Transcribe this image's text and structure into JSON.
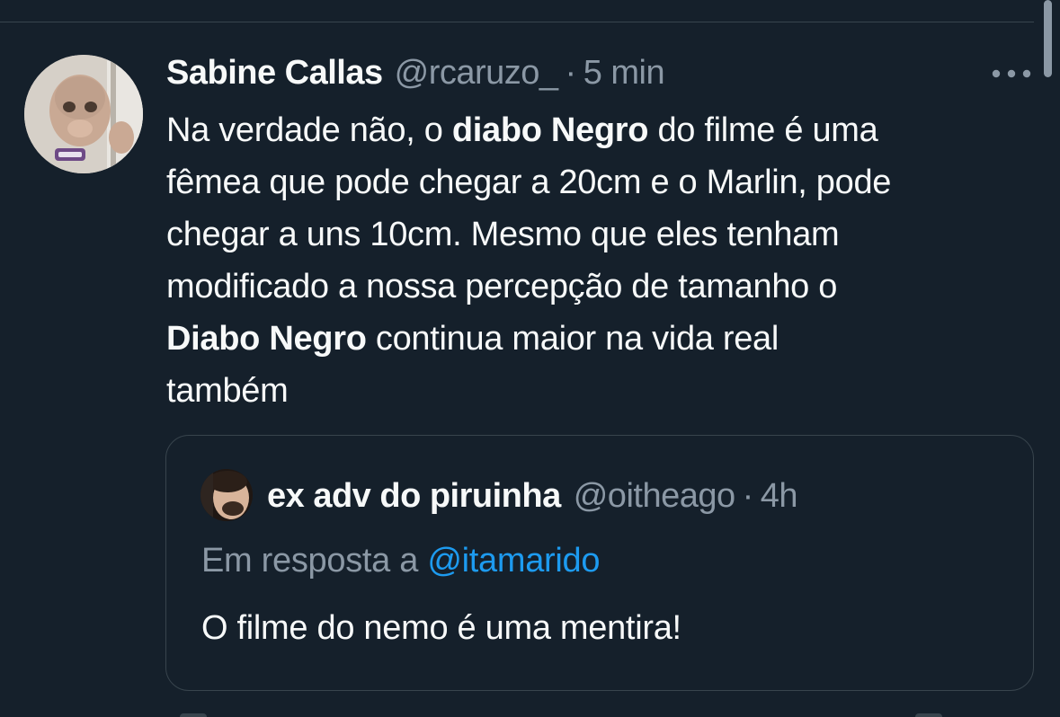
{
  "tweet": {
    "author_name": "Sabine Callas",
    "author_handle": "@rcaruzo_",
    "separator": "·",
    "time": "5 min",
    "more_icon": "more-horizontal-icon",
    "body": {
      "l1_a": "Na verdade não, o ",
      "l1_b": "diabo Negro",
      "l1_c": " do filme é uma",
      "l2": "fêmea que pode chegar a 20cm e o Marlin, pode",
      "l3": "chegar a uns 10cm. Mesmo que eles tenham",
      "l4": "modificado a nossa percepção de tamanho o",
      "l5_a": "Diabo Negro",
      "l5_b": " continua maior na vida real",
      "l6": "também"
    }
  },
  "quoted_tweet": {
    "author_name": "ex adv do piruinha",
    "author_handle": "@oitheago",
    "separator": "·",
    "time": "4h",
    "reply_prefix": "Em resposta a ",
    "reply_mention": "@itamarido",
    "text": "O filme do nemo é uma mentira!"
  },
  "colors": {
    "background": "#15202b",
    "text_primary": "#f7f9f9",
    "text_secondary": "#8b98a5",
    "link": "#1d9bf0",
    "border": "#38444d"
  }
}
